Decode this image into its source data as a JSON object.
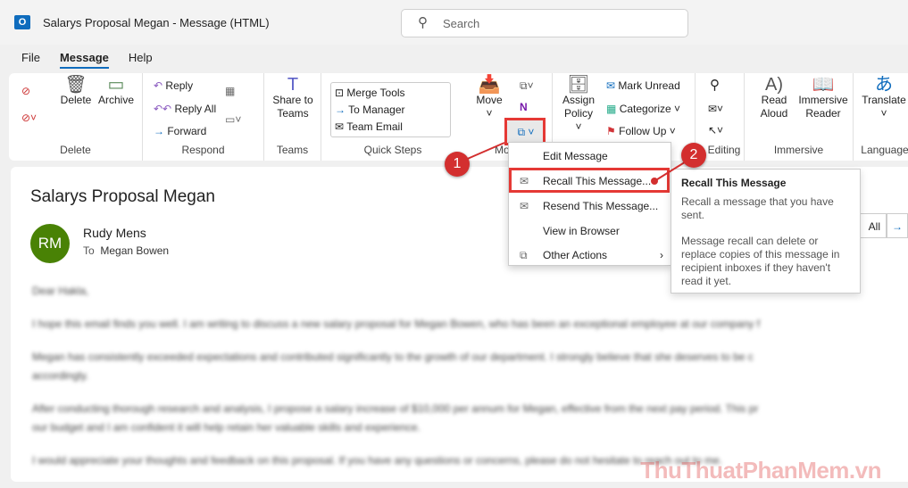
{
  "window": {
    "title": "Salarys Proposal Megan  -  Message (HTML)",
    "search_placeholder": "Search",
    "app_icon": "O"
  },
  "tabs": [
    "File",
    "Message",
    "Help"
  ],
  "ribbon": {
    "delete": {
      "delete": "Delete",
      "archive": "Archive",
      "label": "Delete"
    },
    "respond": {
      "reply": "Reply",
      "reply_all": "Reply All",
      "forward": "Forward",
      "label": "Respond"
    },
    "teams": {
      "share": "Share to Teams",
      "label": "Teams"
    },
    "quick_steps": {
      "items": [
        "Merge Tools",
        "To Manager",
        "Team Email"
      ],
      "label": "Quick Steps"
    },
    "move": {
      "move": "Move",
      "label": "Mo"
    },
    "tags": {
      "assign_policy": "Assign Policy",
      "mark_unread": "Mark Unread",
      "categorize": "Categorize",
      "follow_up": "Follow Up"
    },
    "editing": {
      "label": "Editing"
    },
    "immersive": {
      "read_aloud": "Read Aloud",
      "immersive_reader": "Immersive Reader",
      "label": "Immersive"
    },
    "language": {
      "translate": "Translate",
      "label": "Language"
    }
  },
  "message": {
    "subject": "Salarys Proposal Megan",
    "avatar": "RM",
    "sender": "Rudy Mens",
    "to_label": "To",
    "to": "Megan Bowen",
    "reply_all_partial": "All",
    "body": [
      "Dear Hakla,",
      "I hope this email finds you well. I am writing to discuss a new salary proposal for Megan Bowen, who has been an exceptional employee at our company f",
      "Megan has consistently exceeded expectations and contributed significantly to the growth of our department. I strongly believe that she deserves to be c",
      "accordingly.",
      "After conducting thorough research and analysis, I propose a salary increase of $10,000 per annum for Megan, effective from the next pay period. This pr",
      "our budget and I am confident it will help retain her valuable skills and experience.",
      "I would appreciate your thoughts and feedback on this proposal. If you have any questions or concerns, please do not hesitate to reach out to me."
    ]
  },
  "menu": {
    "items": [
      "Edit Message",
      "Recall This Message...",
      "Resend This Message...",
      "View in Browser",
      "Other Actions"
    ]
  },
  "tooltip": {
    "title": "Recall This Message",
    "line1": "Recall a message that you have sent.",
    "line2": "Message recall can delete or replace copies of this message in recipient inboxes if they haven't read it yet."
  },
  "annotations": [
    "1",
    "2"
  ],
  "accent": "#0f6cbd",
  "highlight": "#e53935",
  "watermark": "ThuThuatPhanMem.vn"
}
